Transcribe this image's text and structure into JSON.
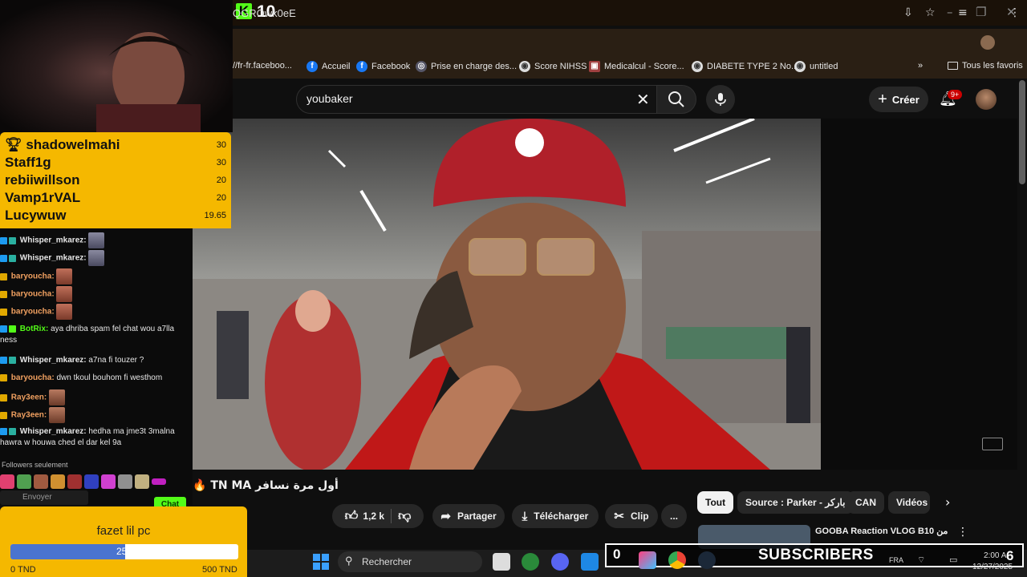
{
  "kick": {
    "count": "10"
  },
  "browser": {
    "url": "QGROwk0eE",
    "bookmarks": [
      {
        "label": "//fr-fr.faceboo..."
      },
      {
        "label": "Accueil"
      },
      {
        "label": "Facebook"
      },
      {
        "label": "Prise en charge des..."
      },
      {
        "label": "Score NIHSS"
      },
      {
        "label": "Medicalcul - Score..."
      },
      {
        "label": "DIABETE TYPE 2 No..."
      },
      {
        "label": "untitled"
      }
    ],
    "bookmarks_more": "»",
    "all_favorites": "Tous les favoris"
  },
  "youtube": {
    "search_value": "youbaker",
    "create_label": "Créer",
    "notif_count": "9+",
    "video_title": "أول مرة نسافر TN MA 🔥",
    "actions": {
      "likes": "1,2 k",
      "share": "Partager",
      "download": "Télécharger",
      "clip": "Clip",
      "more": "..."
    },
    "chips": [
      "Tout",
      "Source : Parker - باركر",
      "CAN",
      "Vidéos s"
    ],
    "recommendation": {
      "title": "GOOBA Reaction VLOG B10 من"
    }
  },
  "leaderboard": [
    {
      "name": "shadowelmahi",
      "score": "30"
    },
    {
      "name": "Staff1g",
      "score": "30"
    },
    {
      "name": "rebiiwillson",
      "score": "20"
    },
    {
      "name": "Vamp1rVAL",
      "score": "20"
    },
    {
      "name": "Lucywuw",
      "score": "19.65"
    }
  ],
  "chat": {
    "messages": [
      {
        "user": "Whisper_mkarez:",
        "text": "",
        "user_color": "#e6e6e6"
      },
      {
        "user": "Whisper_mkarez:",
        "text": "",
        "user_color": "#e6e6e6"
      },
      {
        "user": "baryoucha:",
        "text": "",
        "user_color": "#f0a060"
      },
      {
        "user": "baryoucha:",
        "text": "",
        "user_color": "#f0a060"
      },
      {
        "user": "baryoucha:",
        "text": "",
        "user_color": "#f0a060"
      },
      {
        "user": "BotRix:",
        "text": "aya dhriba spam fel chat wou a7lla",
        "text2": "ness",
        "user_color": "#53fc18"
      },
      {
        "user": "Whisper_mkarez:",
        "text": "a7na fi touzer ?",
        "user_color": "#e6e6e6"
      },
      {
        "user": "baryoucha:",
        "text": "dwn tkoul bouhom fi westhom",
        "user_color": "#f0a060"
      },
      {
        "user": "Ray3een:",
        "text": "",
        "user_color": "#f0a060"
      },
      {
        "user": "Ray3een:",
        "text": "",
        "user_color": "#f0a060"
      },
      {
        "user": "Whisper_mkarez:",
        "text": "hedha ma jme3t 3malna",
        "text2": "hawra w houwa ched el dar kel 9a",
        "user_color": "#e6e6e6"
      }
    ],
    "followers_only": "Followers seulement",
    "send_placeholder": "Envoyer",
    "chat_button": "Chat"
  },
  "goal": {
    "title": "fazet lil pc",
    "current": "251",
    "progress_fraction": 0.502,
    "min_label": "0 TND",
    "max_label": "500 TND"
  },
  "taskbar": {
    "search_label": "Rechercher",
    "subs_count": "0",
    "subs_label": "SUBSCRIBERS",
    "lang": "FRA",
    "time": "2:00 A",
    "date": "12/27/2025",
    "notif_count": "6"
  },
  "colors": {
    "kick_green": "#53fc18",
    "leaderboard_bg": "#f5b800",
    "goal_fill": "#4a74cf"
  }
}
